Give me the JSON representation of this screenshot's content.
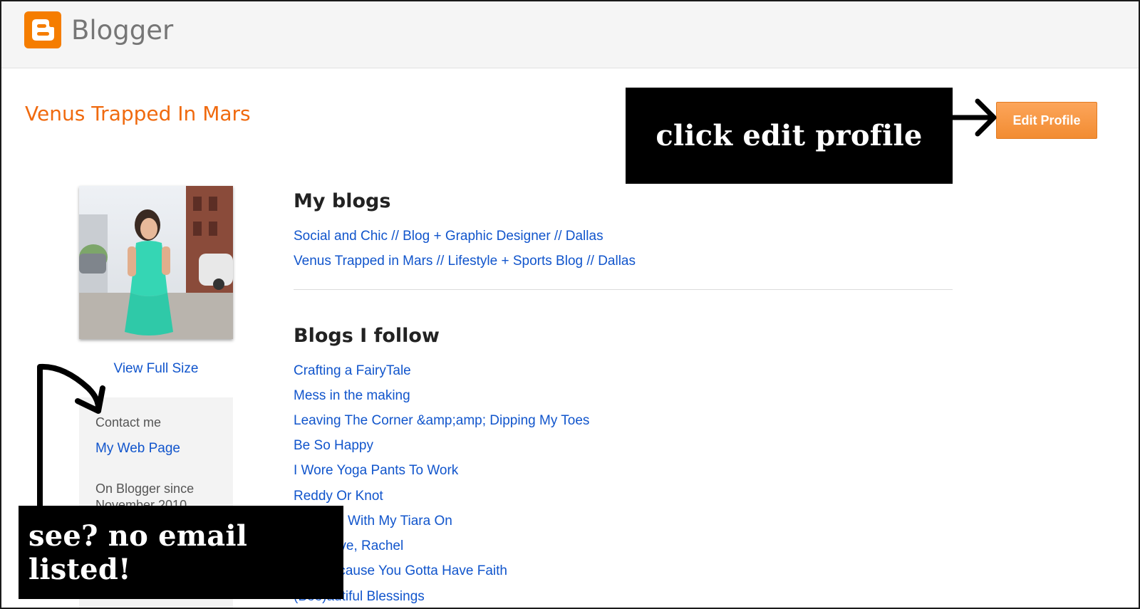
{
  "header": {
    "brand_name": "Blogger",
    "brand_icon": "blogger-logo-icon",
    "brand_color": "#f57d00"
  },
  "profile": {
    "name": "Venus Trapped In Mars",
    "edit_button_label": "Edit Profile",
    "view_full_size_label": "View Full Size",
    "contact_heading": "Contact me",
    "web_page_link": "My Web Page",
    "since_label": "On Blogger since",
    "since_value": "November 2010"
  },
  "my_blogs": {
    "title": "My blogs",
    "items": [
      "Social and Chic // Blog + Graphic Designer // Dallas",
      "Venus Trapped in Mars // Lifestyle + Sports Blog // Dallas"
    ]
  },
  "blogs_followed": {
    "title": "Blogs I follow",
    "items": [
      "Crafting a FairyTale",
      "Mess in the making",
      "Leaving The Corner &amp;amp; Dipping My Toes",
      "Be So Happy",
      "I Wore Yoga Pants To Work",
      "Reddy Or Knot",
      "Running With My Tiara On",
      "With Love, Rachel",
      "Just Because You Gotta Have Faith",
      "(Bee)autiful Blessings"
    ]
  },
  "annotations": {
    "top_callout": "click edit profile",
    "bottom_callout": "see? no email listed!"
  },
  "colors": {
    "link": "#1155cc",
    "title_orange": "#f06a0f",
    "button_orange": "#f28c32"
  }
}
